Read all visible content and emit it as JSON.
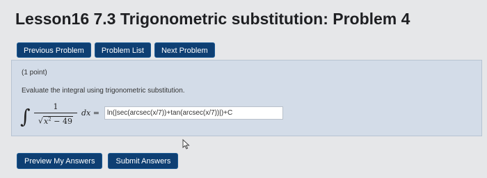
{
  "page": {
    "title": "Lesson16 7.3 Trigonometric substitution: Problem 4"
  },
  "nav": {
    "previous": "Previous Problem",
    "list": "Problem List",
    "next": "Next Problem"
  },
  "problem": {
    "points": "(1 point)",
    "prompt": "Evaluate the integral using trigonometric substitution.",
    "integral_symbol": "∫",
    "numerator": "1",
    "sqrt_symbol": "√",
    "radicand_var": "x",
    "radicand_exp": "2",
    "radicand_rest": " − 49",
    "differential": "dx",
    "equals": "=",
    "answer_value": "ln(|sec(arcsec(x/7))+tan(arcsec(x/7))|)+C"
  },
  "actions": {
    "preview": "Preview My Answers",
    "submit": "Submit Answers"
  },
  "colors": {
    "button_bg": "#0e3f73",
    "panel_bg": "#d3dce8",
    "page_bg": "#e6e7e9"
  },
  "icons": {
    "cursor": "mouse-pointer-icon"
  }
}
